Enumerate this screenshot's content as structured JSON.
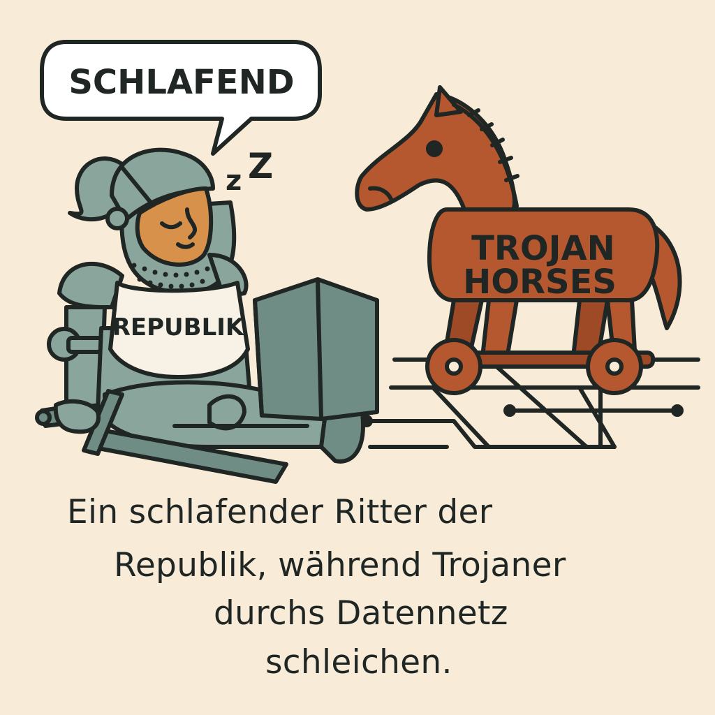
{
  "speech_bubble": {
    "text": "SCHLAFEND"
  },
  "snore": {
    "small": "z",
    "big": "Z"
  },
  "knight": {
    "shirt_label": "REPUBLIK"
  },
  "horse": {
    "line1": "TROJAN",
    "line2": "HORSES"
  },
  "caption": {
    "line1": "Ein schlafender Ritter der",
    "line2": "Republik, während Trojaner",
    "line3": "durchs Datennetz",
    "line4": "schleichen."
  },
  "colors": {
    "background": "#f8ecd8",
    "outline": "#1f2624",
    "armor": "#8aa59c",
    "armor_dark": "#6f8d84",
    "skin": "#d8914a",
    "horse": "#b5582f",
    "shirt": "#f8f2e6"
  }
}
